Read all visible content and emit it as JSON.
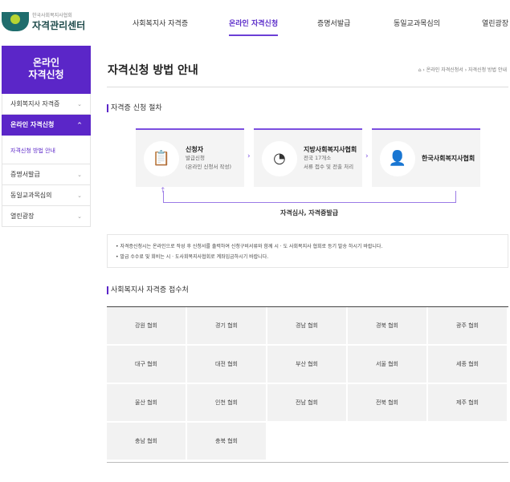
{
  "logo": {
    "small": "한국사회복지사협회",
    "big": "자격관리센터"
  },
  "gnb": [
    "사회복지사 자격증",
    "온라인 자격신청",
    "증명서발급",
    "동일교과목심의",
    "열린광장"
  ],
  "side": {
    "title_line1": "온라인",
    "title_line2": "자격신청",
    "items": [
      {
        "label": "사회복지사 자격증",
        "chev": "⌄"
      },
      {
        "label": "온라인 자격신청",
        "chev": "^"
      },
      {
        "label": "증명서발급",
        "chev": "⌄"
      },
      {
        "label": "동일교과목심의",
        "chev": "⌄"
      },
      {
        "label": "열린광장",
        "chev": "⌄"
      }
    ],
    "sub": "자격신청 방법 안내"
  },
  "page": {
    "title": "자격신청 방법 안내",
    "breadcrumb": "⌂ › 온라인 자격신청서 › 자격신청 방법 안내"
  },
  "process": {
    "heading": "자격증 신청 절차",
    "steps": [
      {
        "name": "신청자",
        "l1": "발급신청",
        "l2": "(온라인 신청서 작성)"
      },
      {
        "name": "지방사회복지사협회",
        "l1": "전국 17개소",
        "l2": "서류 접수 및 전출 처리"
      },
      {
        "name": "한국사회복지사협회",
        "l1": "",
        "l2": ""
      }
    ],
    "loop": "자격심사, 자격증발급"
  },
  "notes": [
    "• 자격증신청시는 온라인으로 작성 후 신청서를 출력하여 신청구비서류와 함께 시 · 도 사회복지사 협회로 등기 발송 하시기 바랍니다.",
    "• 발급 수수료 및 회비는 시 · 도사회복지사협회로 계좌입금하시기 바랍니다."
  ],
  "offices": {
    "heading": "사회복지사 자격증 접수처",
    "list": [
      "강원 협회",
      "경기 협회",
      "경남 협회",
      "경북 협회",
      "광주 협회",
      "대구 협회",
      "대전 협회",
      "부산 협회",
      "서울 협회",
      "세종 협회",
      "울산 협회",
      "인천 협회",
      "전남 협회",
      "전북 협회",
      "제주 협회",
      "충남 협회",
      "충북 협회"
    ]
  }
}
